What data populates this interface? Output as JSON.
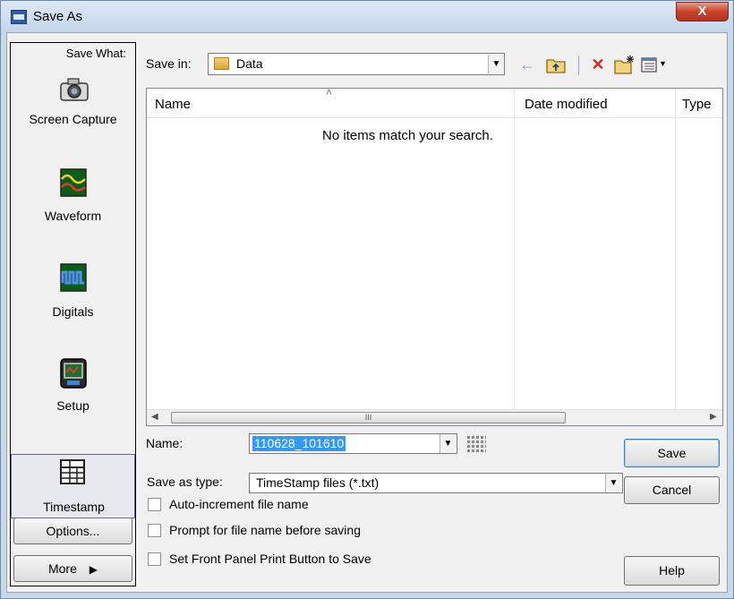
{
  "window": {
    "title": "Save As",
    "close_label": "X"
  },
  "left_panel": {
    "heading": "Save What:",
    "categories": [
      {
        "label": "Screen Capture",
        "icon": "camera-icon"
      },
      {
        "label": "Waveform",
        "icon": "waveform-icon"
      },
      {
        "label": "Digitals",
        "icon": "digitals-icon"
      },
      {
        "label": "Setup",
        "icon": "setup-icon"
      },
      {
        "label": "Timestamp",
        "icon": "timestamp-icon",
        "selected": true
      }
    ],
    "options_label": "Options...",
    "more_label": "More",
    "more_arrow": "▶"
  },
  "save_in": {
    "label": "Save in:",
    "value": "Data",
    "icon": "folder-icon"
  },
  "toolbar": {
    "back_icon": "←",
    "up_icon": "⬑",
    "delete_icon": "✕",
    "new_folder_icon": "✱",
    "views_icon": "▦"
  },
  "list": {
    "columns": [
      "Name",
      "Date modified",
      "Type"
    ],
    "sort_indicator": "˄",
    "empty_message": "No items match your search.",
    "scroll_grip": "III"
  },
  "form": {
    "name_label": "Name:",
    "name_value": "110628_101610",
    "type_label": "Save as type:",
    "type_value": "TimeStamp files (*.txt)"
  },
  "checkboxes": [
    {
      "label": "Auto-increment file name",
      "checked": false
    },
    {
      "label": "Prompt for file name before saving",
      "checked": false
    },
    {
      "label": "Set Front Panel Print Button to Save",
      "checked": false
    }
  ],
  "buttons": {
    "save": "Save",
    "cancel": "Cancel",
    "help": "Help"
  },
  "colors": {
    "selection": "#3399ff",
    "close_red": "#c9422c",
    "frame": "#c9d9ec"
  }
}
